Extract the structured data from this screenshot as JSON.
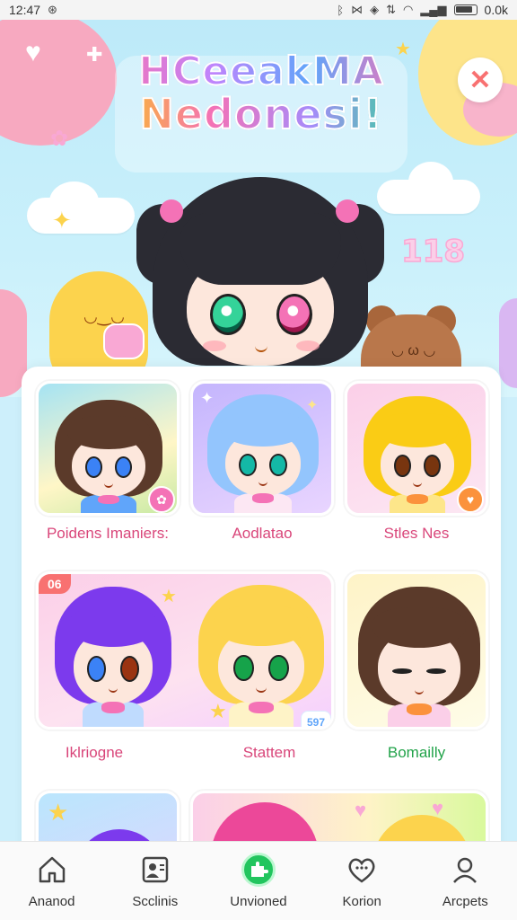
{
  "status_bar": {
    "time": "12:47",
    "right_text": "0.0k"
  },
  "hero": {
    "title_line1": "HCeeakMA",
    "title_line2": "Nedonesi!",
    "badge": "118",
    "close_icon": "close-icon"
  },
  "cards": [
    {
      "label": "Poidens Imaniers:",
      "label_color": "#d9467a"
    },
    {
      "label": "Aodlatao",
      "label_color": "#d9467a"
    },
    {
      "label": "Stles Nes",
      "label_color": "#d9467a"
    },
    {
      "label": "Iklriogne",
      "label_color": "#d9467a",
      "badge": "06"
    },
    {
      "label": "Stattem",
      "label_color": "#d9467a",
      "badge": "597"
    },
    {
      "label": "Bomailly",
      "label_color": "#22a34a"
    }
  ],
  "bottom_nav": {
    "items": [
      {
        "label": "Ananod",
        "icon": "home-icon"
      },
      {
        "label": "Scclinis",
        "icon": "contact-card-icon"
      },
      {
        "label": "Unvioned",
        "icon": "puzzle-icon",
        "active": true
      },
      {
        "label": "Korion",
        "icon": "heart-chat-icon"
      },
      {
        "label": "Arcpets",
        "icon": "profile-icon"
      }
    ]
  },
  "colors": {
    "accent_pink": "#f472b6",
    "active_green": "#22c55e",
    "label_pink": "#d9467a",
    "label_green": "#22a34a"
  }
}
